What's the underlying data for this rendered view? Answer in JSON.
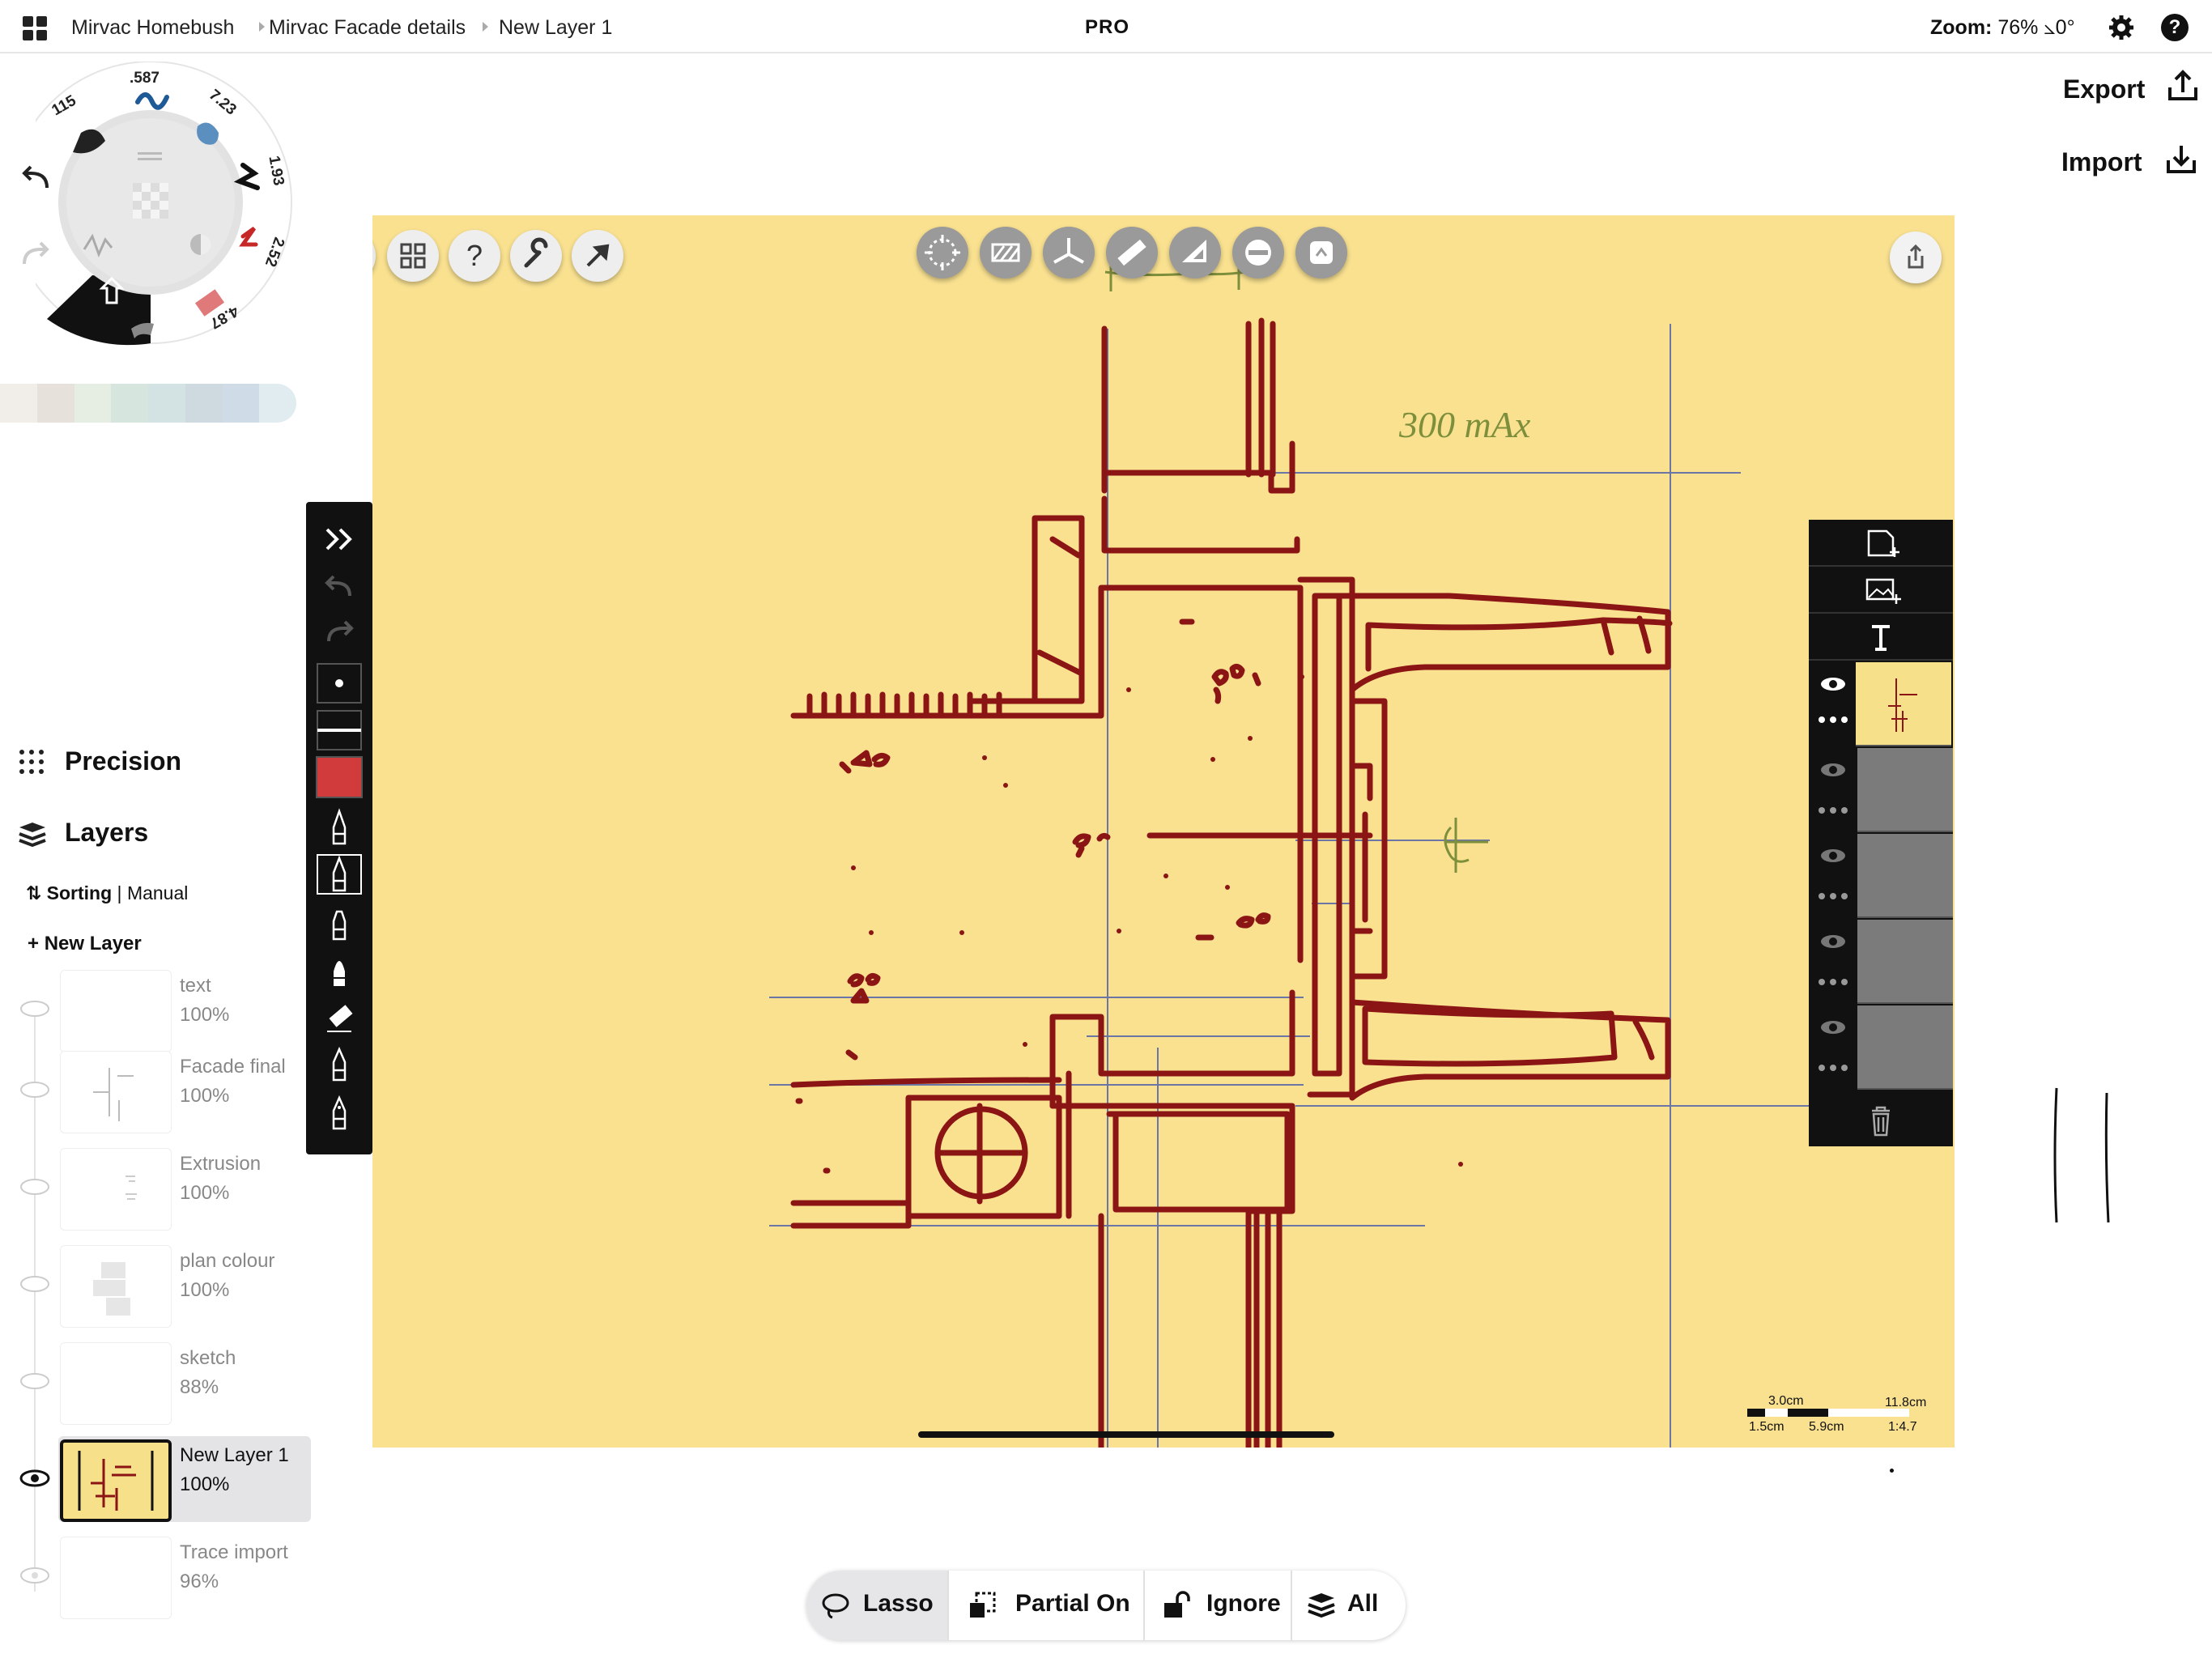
{
  "breadcrumb": {
    "items": [
      "Mirvac Homebush",
      "Mirvac Facade details",
      "New Layer 1"
    ]
  },
  "header": {
    "badge": "PRO",
    "zoom_label": "Zoom:",
    "zoom_value": "76% ⦣0°"
  },
  "actions": {
    "export_label": "Export",
    "import_label": "Import"
  },
  "wheel": {
    "sizes": [
      ".587",
      "7.23",
      "1.93",
      "2.52",
      "4.87",
      "115"
    ]
  },
  "palette": {
    "colors": [
      "#f1eeea",
      "#e7e1dc",
      "#e6ede3",
      "#d6e6de",
      "#d3e3e4",
      "#cfd9e0",
      "#cfdce8",
      "#e0ecef"
    ]
  },
  "sidebar": {
    "precision_label": "Precision",
    "layers_label": "Layers",
    "sorting_label": "Sorting",
    "sorting_sep": " | ",
    "sorting_mode": "Manual",
    "new_layer_label": "New Layer",
    "layers": [
      {
        "name": "text",
        "opacity": "100%"
      },
      {
        "name": "Facade final",
        "opacity": "100%"
      },
      {
        "name": "Extrusion",
        "opacity": "100%"
      },
      {
        "name": "plan colour",
        "opacity": "100%"
      },
      {
        "name": "sketch",
        "opacity": "88%"
      },
      {
        "name": "New Layer 1",
        "opacity": "100%"
      },
      {
        "name": "Trace import",
        "opacity": "96%"
      }
    ],
    "active_layer": "New Layer 1"
  },
  "brush": {
    "color": "#d23b3b"
  },
  "canvas": {
    "background": "#f9e190",
    "ink": "#8b1414",
    "annotation_text": "300 mAx",
    "centerline_glyph": "℄"
  },
  "scale_bar": {
    "a": "3.0cm",
    "b": "11.8cm",
    "c": "1.5cm",
    "d": "5.9cm",
    "ratio": "1:4.7"
  },
  "selection": {
    "lasso_label": "Lasso",
    "partial_label": "Partial On",
    "ignore_label": "Ignore",
    "all_label": "All"
  }
}
